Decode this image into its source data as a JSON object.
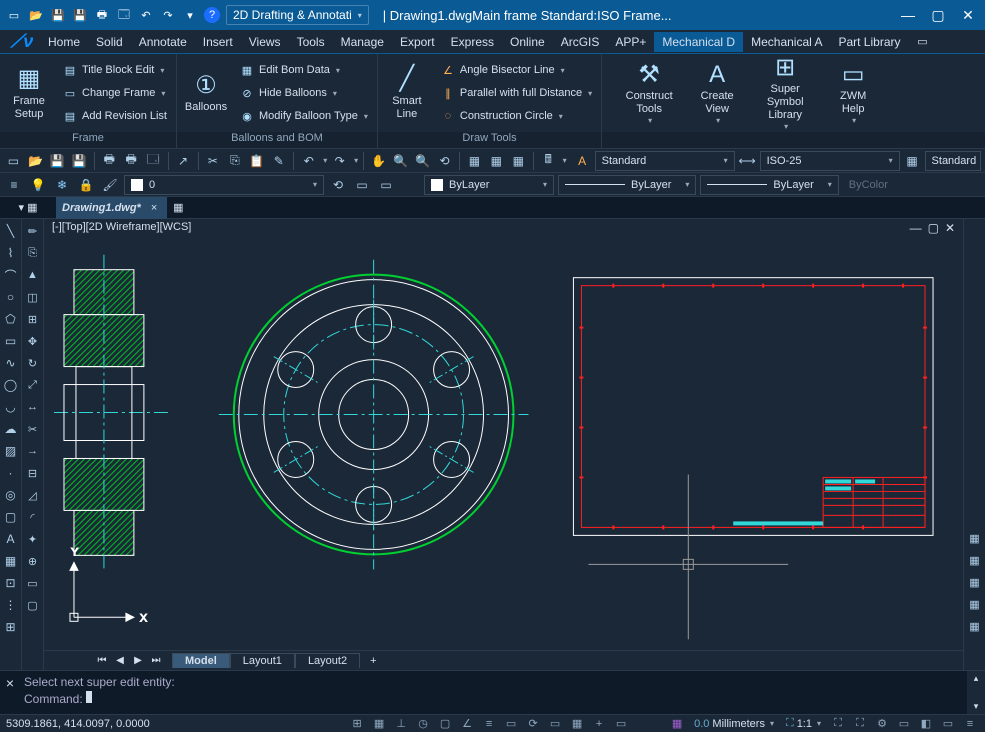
{
  "title_bar": {
    "workspace": "2D Drafting & Annotati",
    "title": "Drawing1.dwgMain frame  Standard:ISO Frame..."
  },
  "menu": {
    "items": [
      "Home",
      "Solid",
      "Annotate",
      "Insert",
      "Views",
      "Tools",
      "Manage",
      "Export",
      "Express",
      "Online",
      "ArcGIS",
      "APP+",
      "Mechanical D",
      "Mechanical A",
      "Part Library"
    ],
    "active_index": 12
  },
  "ribbon": {
    "groups": [
      {
        "label": "Frame",
        "big": {
          "label": "Frame\nSetup"
        },
        "items": [
          "Title Block Edit",
          "Change Frame",
          "Add Revision List"
        ]
      },
      {
        "label": "Balloons and BOM",
        "big": {
          "label": "Balloons"
        },
        "items": [
          "Edit Bom Data",
          "Hide Balloons",
          "Modify Balloon Type"
        ]
      },
      {
        "label": "Draw Tools",
        "big": {
          "label": "Smart\nLine"
        },
        "items": [
          "Angle Bisector Line",
          "Parallel with full Distance",
          "Construction Circle"
        ]
      }
    ],
    "right_big": [
      {
        "label": "Construct\nTools"
      },
      {
        "label": "Create\nView"
      },
      {
        "label": "Super Symbol\nLibrary"
      },
      {
        "label": "ZWM\nHelp"
      }
    ]
  },
  "toolbars": {
    "text_style": "Standard",
    "dim_style": "ISO-25",
    "table_style": "Standard"
  },
  "props": {
    "layer": "0",
    "color": "ByLayer",
    "linetype": "ByLayer",
    "lineweight": "ByLayer",
    "plotstyle": "ByColor"
  },
  "doc_tab": {
    "name": "Drawing1.dwg*"
  },
  "viewport": {
    "label": "[-][Top][2D Wireframe][WCS]",
    "axis_x": "X",
    "axis_y": "Y"
  },
  "layout_tabs": {
    "tabs": [
      "Model",
      "Layout1",
      "Layout2"
    ],
    "active_index": 0,
    "add": "+"
  },
  "command": {
    "line1": "Select next super edit entity:",
    "line2": "Command:"
  },
  "status": {
    "coords": "5309.1861, 414.0097, 0.0000",
    "units": "Millimeters",
    "scale": "1:1",
    "units_prefix": "0.0"
  }
}
